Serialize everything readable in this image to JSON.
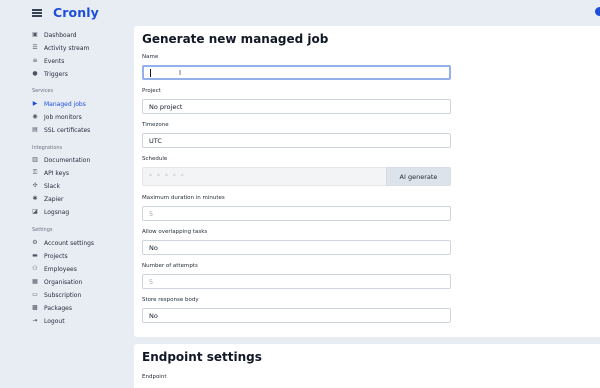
{
  "app": {
    "brand": "Cronly"
  },
  "sidebar": {
    "main_items": [
      {
        "label": "Dashboard",
        "icon": "dashboard-icon"
      },
      {
        "label": "Activity stream",
        "icon": "list-icon"
      },
      {
        "label": "Events",
        "icon": "events-icon"
      },
      {
        "label": "Triggers",
        "icon": "trigger-icon"
      }
    ],
    "services_title": "Services",
    "services_items": [
      {
        "label": "Managed jobs",
        "icon": "play-icon",
        "active": true
      },
      {
        "label": "Job monitors",
        "icon": "monitor-icon"
      },
      {
        "label": "SSL certificates",
        "icon": "certificate-icon"
      }
    ],
    "integrations_title": "Integrations",
    "integrations_items": [
      {
        "label": "Documentation",
        "icon": "book-icon"
      },
      {
        "label": "API keys",
        "icon": "key-icon"
      },
      {
        "label": "Slack",
        "icon": "slack-icon"
      },
      {
        "label": "Zapier",
        "icon": "zapier-icon"
      },
      {
        "label": "Logsnag",
        "icon": "logsnag-icon"
      }
    ],
    "settings_title": "Settings",
    "settings_items": [
      {
        "label": "Account settings",
        "icon": "gear-icon"
      },
      {
        "label": "Projects",
        "icon": "folder-icon"
      },
      {
        "label": "Employees",
        "icon": "users-icon"
      },
      {
        "label": "Organisation",
        "icon": "building-icon"
      },
      {
        "label": "Subscription",
        "icon": "subscription-icon"
      },
      {
        "label": "Packages",
        "icon": "package-icon"
      },
      {
        "label": "Logout",
        "icon": "logout-icon"
      }
    ]
  },
  "form": {
    "title": "Generate new managed job",
    "name_label": "Name",
    "name_value": "",
    "project_label": "Project",
    "project_value": "No project",
    "timezone_label": "Timezone",
    "timezone_value": "UTC",
    "schedule_label": "Schedule",
    "schedule_placeholder": "* * * * *",
    "ai_generate_label": "AI generate",
    "max_duration_label": "Maximum duration in minutes",
    "max_duration_placeholder": "5",
    "overlap_label": "Allow overlapping tasks",
    "overlap_value": "No",
    "attempts_label": "Number of attempts",
    "attempts_placeholder": "5",
    "store_body_label": "Store response body",
    "store_body_value": "No"
  },
  "endpoint": {
    "title": "Endpoint settings",
    "endpoint_label": "Endpoint"
  },
  "colors": {
    "accent": "#1d4ed8",
    "background": "#e8edf4",
    "focus_border": "#93b0e8"
  }
}
